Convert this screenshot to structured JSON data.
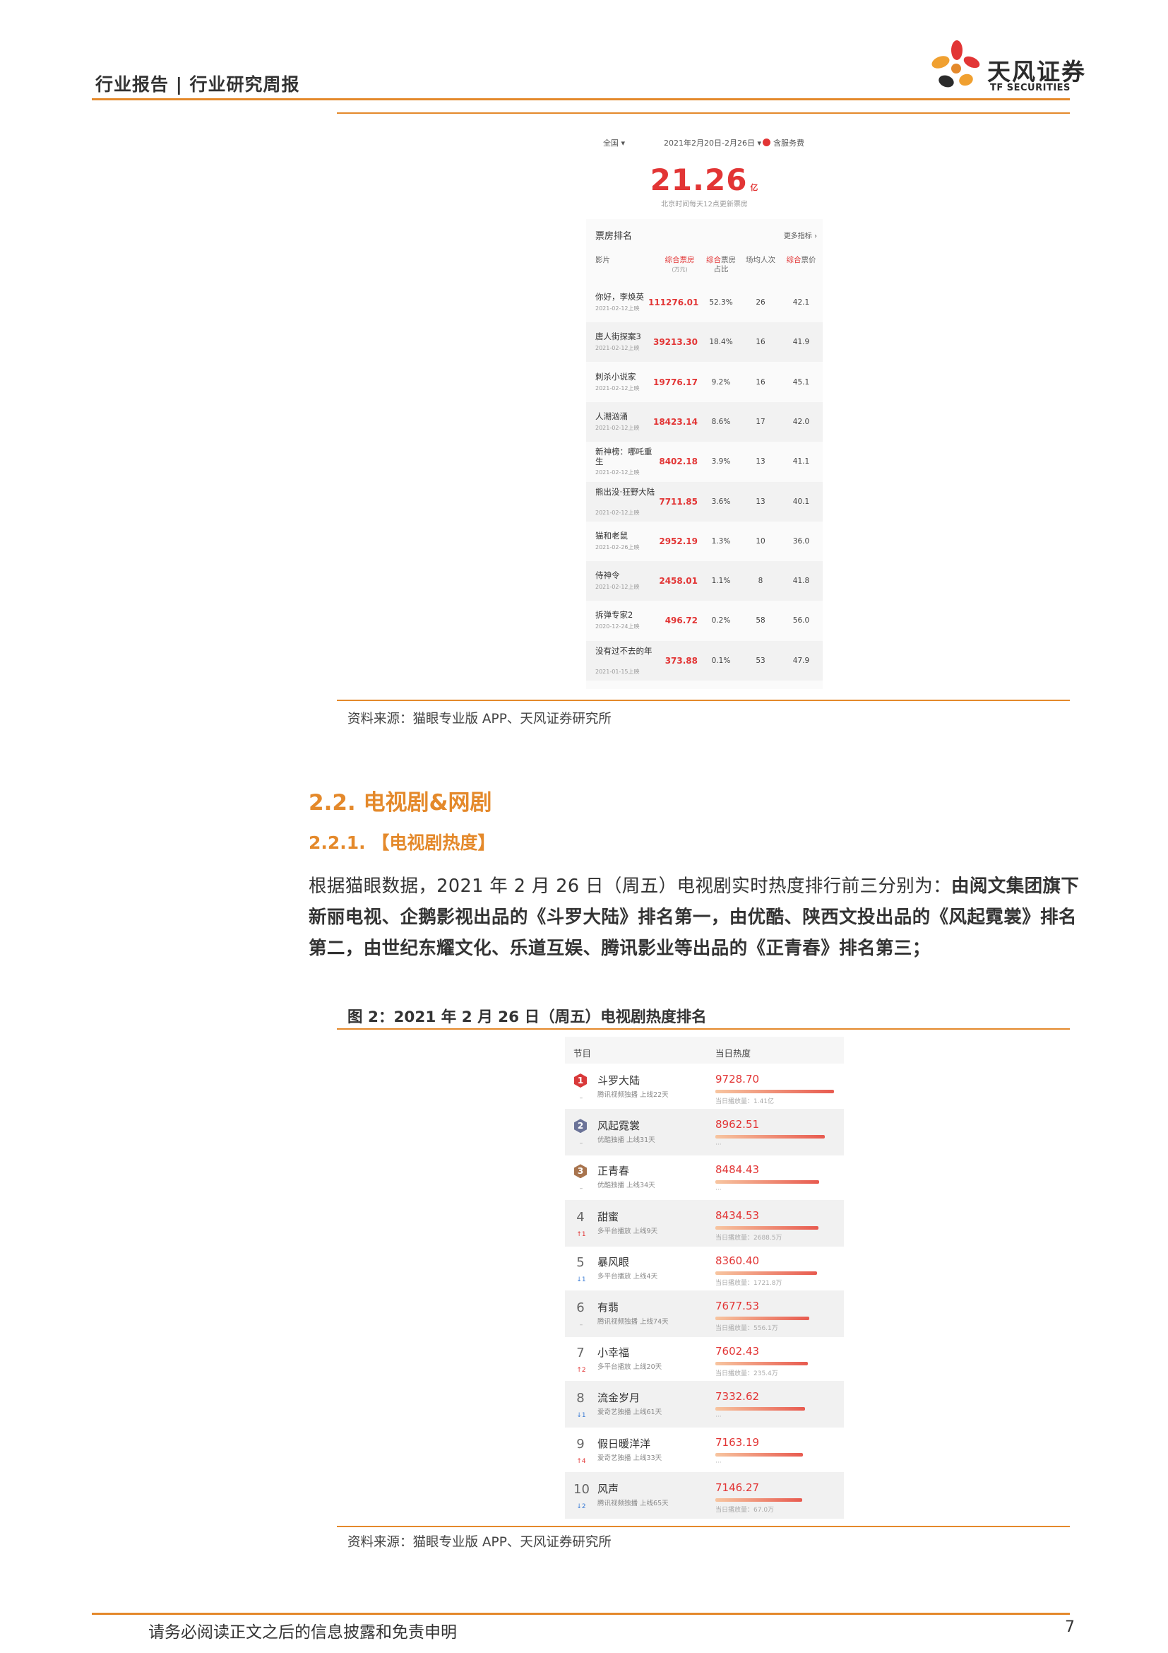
{
  "header": {
    "title": "行业报告 | 行业研究周报",
    "logo_cn": "天风证券",
    "logo_en": "TF SECURITIES"
  },
  "box_office": {
    "region": "全国",
    "date_range": "2021年2月20日-2月26日",
    "service_fee": "含服务费",
    "total": "21.26",
    "total_unit": "亿",
    "update_note": "北京时间每天12点更新票房",
    "panel_title": "票房排名",
    "more_link": "更多指标",
    "columns": {
      "film": "影片",
      "gross": "综合票房",
      "gross_unit": "(万元)",
      "share_red": "综合",
      "share": "票房占比",
      "avg_people": "场均人次",
      "price_red": "综合",
      "price": "票价"
    },
    "rows": [
      {
        "name": "你好，李焕英",
        "date": "2021-02-12上映",
        "gross": "111276.01",
        "share": "52.3%",
        "people": "26",
        "price": "42.1"
      },
      {
        "name": "唐人街探案3",
        "date": "2021-02-12上映",
        "gross": "39213.30",
        "share": "18.4%",
        "people": "16",
        "price": "41.9"
      },
      {
        "name": "刺杀小说家",
        "date": "2021-02-12上映",
        "gross": "19776.17",
        "share": "9.2%",
        "people": "16",
        "price": "45.1"
      },
      {
        "name": "人潮汹涌",
        "date": "2021-02-12上映",
        "gross": "18423.14",
        "share": "8.6%",
        "people": "17",
        "price": "42.0"
      },
      {
        "name": "新神榜：哪吒重生",
        "date": "2021-02-12上映",
        "gross": "8402.18",
        "share": "3.9%",
        "people": "13",
        "price": "41.1"
      },
      {
        "name": "熊出没·狂野大陆",
        "date": "2021-02-12上映",
        "gross": "7711.85",
        "share": "3.6%",
        "people": "13",
        "price": "40.1"
      },
      {
        "name": "猫和老鼠",
        "date": "2021-02-26上映",
        "gross": "2952.19",
        "share": "1.3%",
        "people": "10",
        "price": "36.0"
      },
      {
        "name": "侍神令",
        "date": "2021-02-12上映",
        "gross": "2458.01",
        "share": "1.1%",
        "people": "8",
        "price": "41.8"
      },
      {
        "name": "拆弹专家2",
        "date": "2020-12-24上映",
        "gross": "496.72",
        "share": "0.2%",
        "people": "58",
        "price": "56.0"
      },
      {
        "name": "没有过不去的年",
        "date": "2021-01-15上映",
        "gross": "373.88",
        "share": "0.1%",
        "people": "53",
        "price": "47.9"
      }
    ]
  },
  "source1": "资料来源：猫眼专业版 APP、天风证券研究所",
  "section": {
    "h2": "2.2. 电视剧&网剧",
    "h3": "2.2.1. 【电视剧热度】",
    "para_normal": "根据猫眼数据，2021 年 2 月 26 日（周五）电视剧实时热度排行前三分别为：",
    "para_bold": "由阅文集团旗下新丽电视、企鹅影视出品的《斗罗大陆》排名第一，由优酷、陕西文投出品的《风起霓裳》排名第二，由世纪东耀文化、乐道互娱、腾讯影业等出品的《正青春》排名第三；"
  },
  "fig2_title": "图 2：2021 年 2 月 26 日（周五）电视剧热度排名",
  "tv": {
    "col_show": "节目",
    "col_heat": "当日热度",
    "rows": [
      {
        "rank": "1",
        "name": "斗罗大陆",
        "meta": "腾讯视频独播  上线22天",
        "change": "–",
        "heat": "9728.70",
        "views": "当日播放量：1.41亿",
        "heat_value": 9728.7,
        "badge": "#d9393a"
      },
      {
        "rank": "2",
        "name": "风起霓裳",
        "meta": "优酷独播  上线31天",
        "change": "–",
        "heat": "8962.51",
        "views": "···",
        "heat_value": 8962.51,
        "badge": "#6b7398"
      },
      {
        "rank": "3",
        "name": "正青春",
        "meta": "优酷独播  上线34天",
        "change": "–",
        "heat": "8484.43",
        "views": "···",
        "heat_value": 8484.43,
        "badge": "#a8744e"
      },
      {
        "rank": "4",
        "name": "甜蜜",
        "meta": "多平台播放  上线9天",
        "change": "↑1",
        "heat": "8434.53",
        "views": "当日播放量：2688.5万",
        "heat_value": 8434.53
      },
      {
        "rank": "5",
        "name": "暴风眼",
        "meta": "多平台播放  上线4天",
        "change": "↓1",
        "heat": "8360.40",
        "views": "当日播放量：1721.8万",
        "heat_value": 8360.4
      },
      {
        "rank": "6",
        "name": "有翡",
        "meta": "腾讯视频独播  上线74天",
        "change": "–",
        "heat": "7677.53",
        "views": "当日播放量：556.1万",
        "heat_value": 7677.53
      },
      {
        "rank": "7",
        "name": "小幸福",
        "meta": "多平台播放  上线20天",
        "change": "↑2",
        "heat": "7602.43",
        "views": "当日播放量：235.4万",
        "heat_value": 7602.43
      },
      {
        "rank": "8",
        "name": "流金岁月",
        "meta": "爱奇艺独播  上线61天",
        "change": "↓1",
        "heat": "7332.62",
        "views": "···",
        "heat_value": 7332.62
      },
      {
        "rank": "9",
        "name": "假日暖洋洋",
        "meta": "爱奇艺独播  上线33天",
        "change": "↑4",
        "heat": "7163.19",
        "views": "···",
        "heat_value": 7163.19
      },
      {
        "rank": "10",
        "name": "风声",
        "meta": "腾讯视频独播  上线65天",
        "change": "↓2",
        "heat": "7146.27",
        "views": "当日播放量：67.0万",
        "heat_value": 7146.27
      }
    ]
  },
  "source2": "资料来源：猫眼专业版 APP、天风证券研究所",
  "footer": {
    "disclaimer": "请务必阅读正文之后的信息披露和免责申明",
    "page": "7"
  },
  "colors": {
    "accent": "#e4892b",
    "red": "#e23535"
  }
}
